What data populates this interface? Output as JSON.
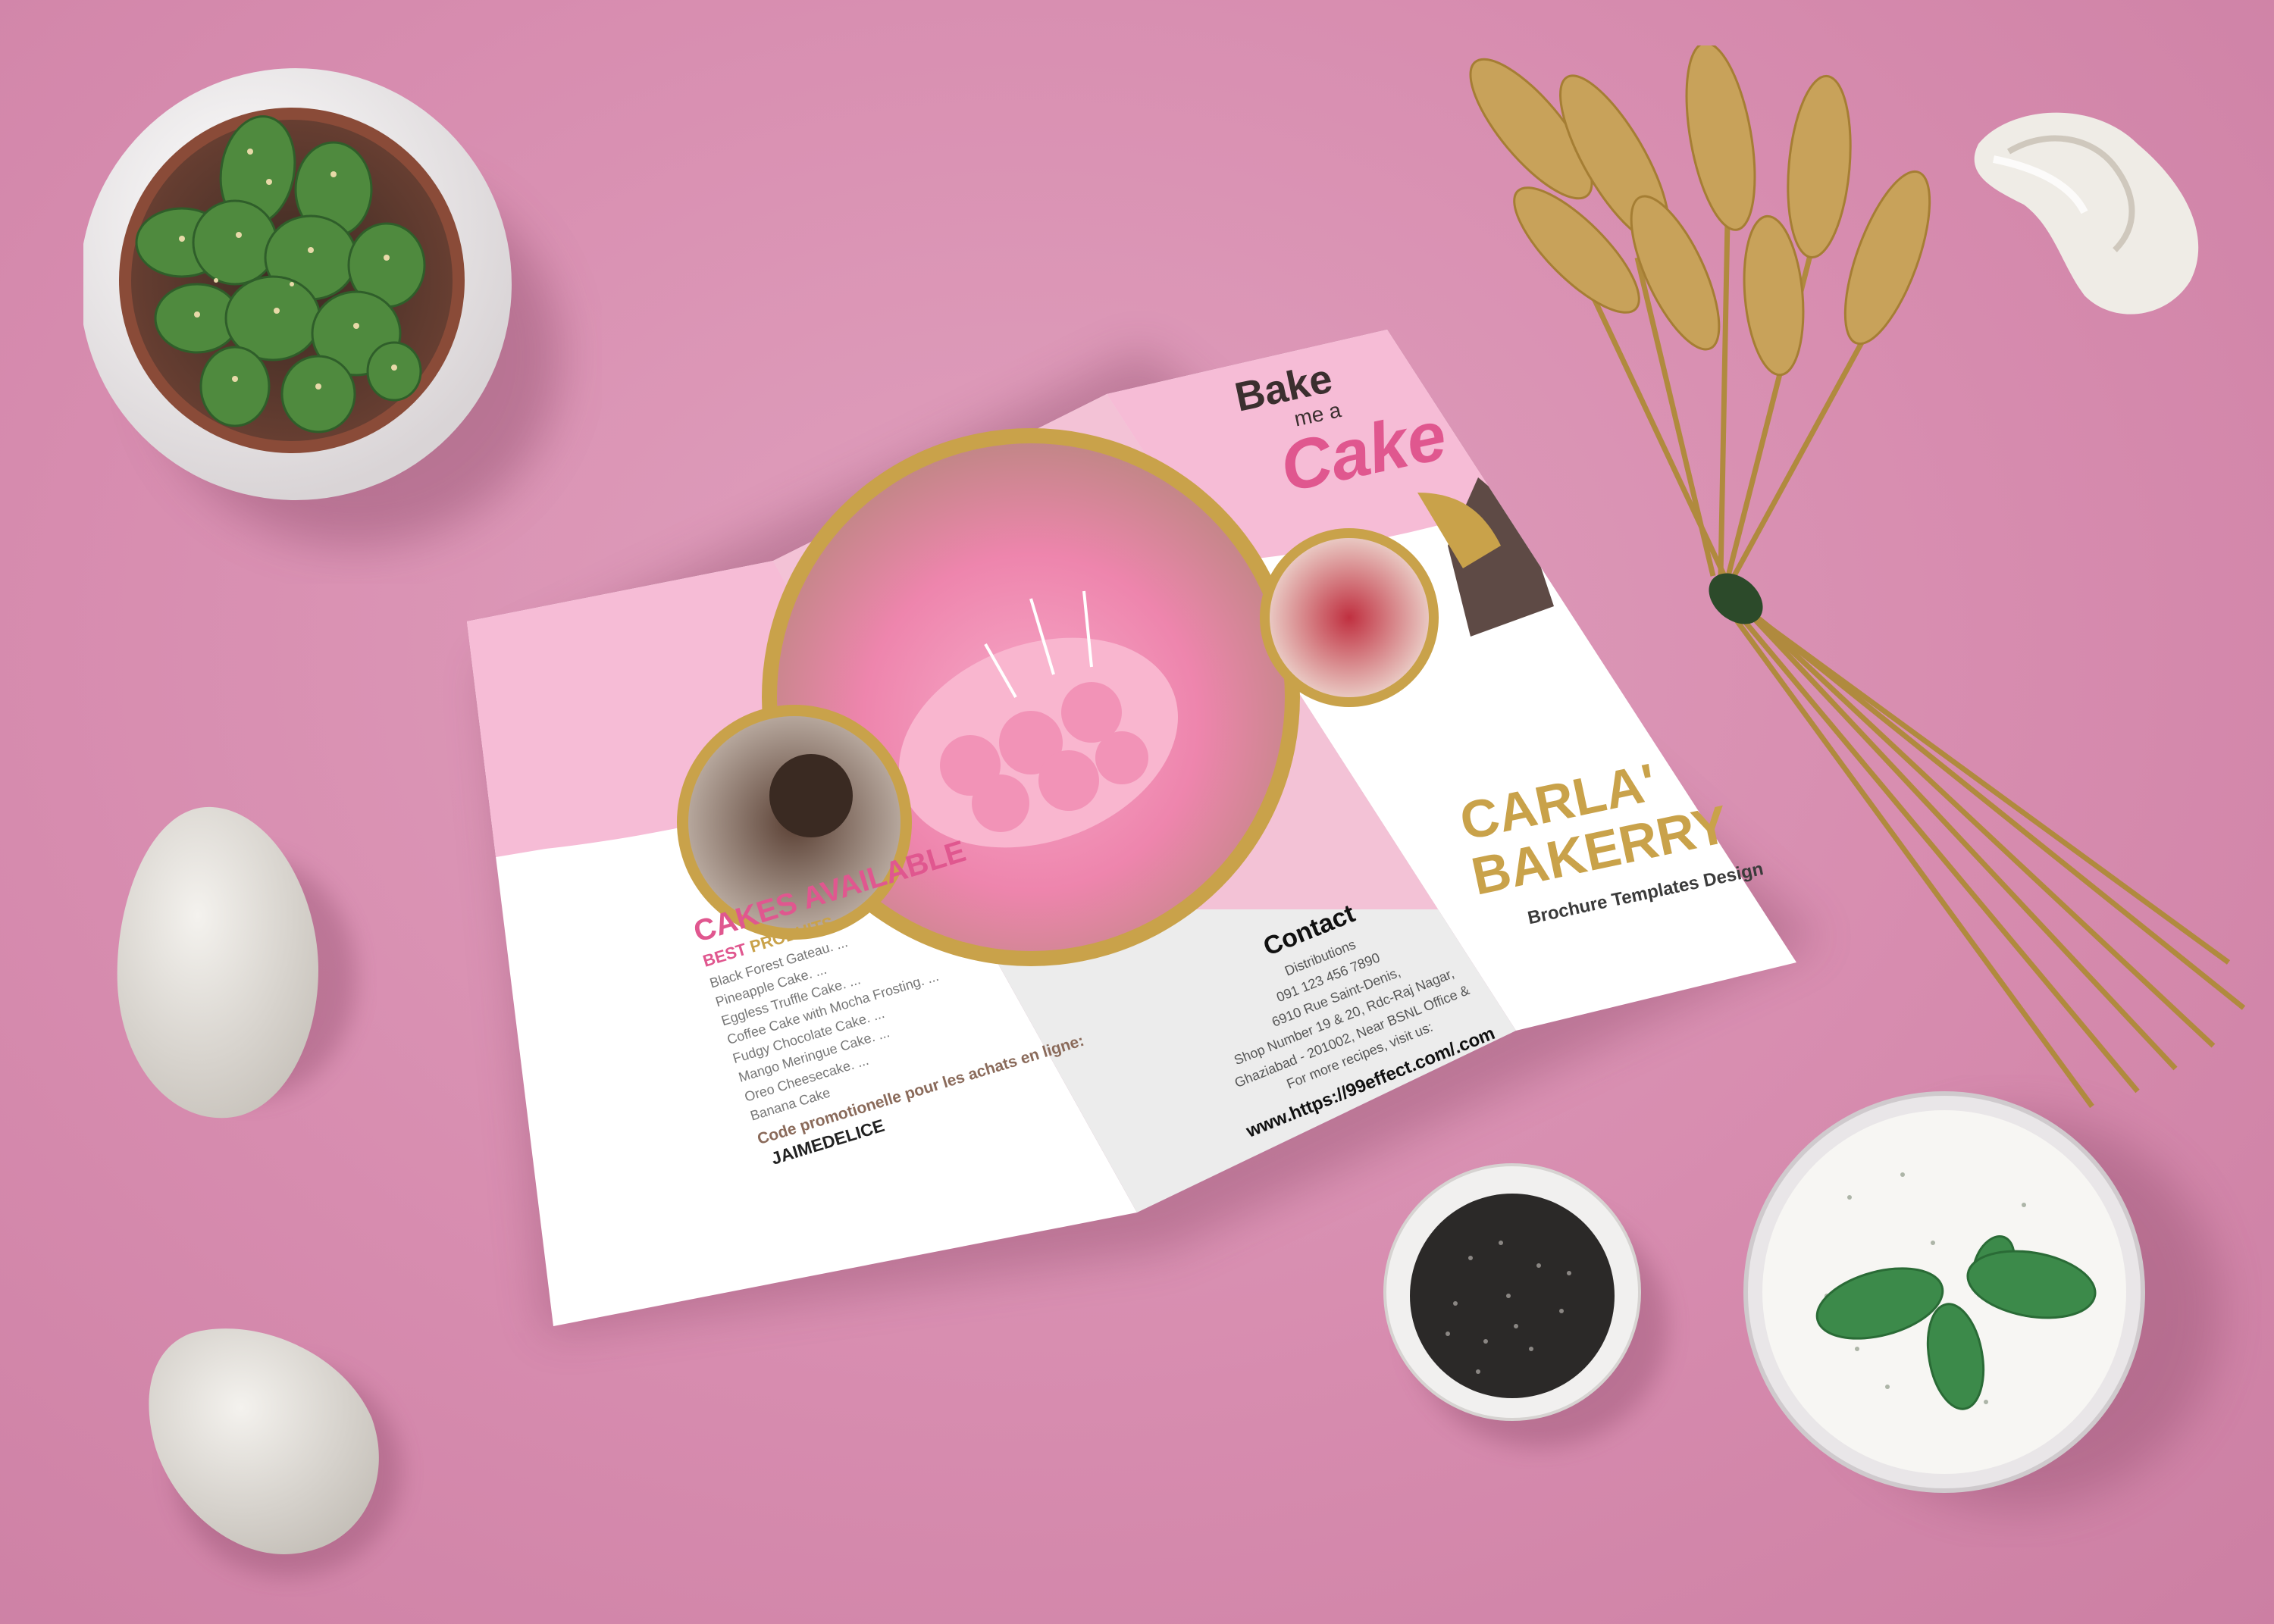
{
  "brochure": {
    "logo": {
      "line1": "Bake",
      "line2": "me a",
      "line3": "Cake"
    },
    "cover": {
      "title_line1": "CARLA'",
      "title_line2": "BAKERRY",
      "subtitle": "Brochure Templates Design"
    },
    "contact": {
      "heading": "Contact",
      "lines": [
        "Distributions",
        "091 123 456 7890",
        "6910 Rue Saint-Denis,",
        "Shop Number 19 & 20, Rdc-Raj Nagar,",
        "Ghaziabad - 201002, Near BSNL Office &",
        "For more recipes, visit us:"
      ],
      "url": "www.https://99effect.com/.com"
    },
    "menu": {
      "heading": "CAKES AVAILABLE",
      "sub_best": "BEST",
      "sub_produits": "PRODUITS",
      "items": [
        "Black Forest Gateau. ...",
        "Pineapple Cake. ...",
        "Eggless Truffle Cake. ...",
        "Coffee Cake with Mocha Frosting. ...",
        "Fudgy Chocolate Cake. ...",
        "Mango Meringue Cake. ...",
        "Oreo Cheesecake. ...",
        "Banana Cake"
      ],
      "promo_label": "Code promotionelle pour les achats en ligne:",
      "promo_code": "JAIMEDELICE"
    }
  },
  "colors": {
    "background": "#d98fb0",
    "brand_pink": "#e0578f",
    "gold": "#c9a24a",
    "light_pink": "#f6bcd6"
  }
}
